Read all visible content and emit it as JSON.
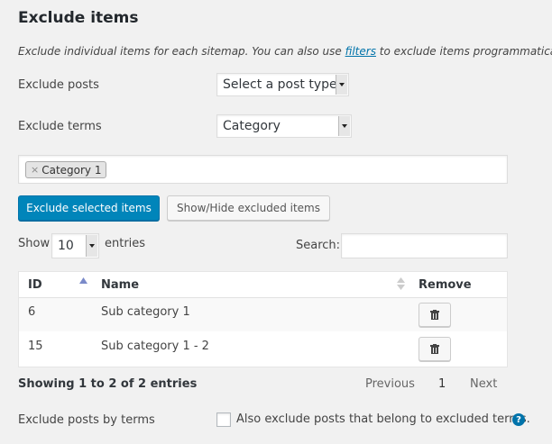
{
  "section": {
    "title": "Exclude items",
    "description_before": "Exclude individual items for each sitemap. You can also use ",
    "description_link": "filters",
    "description_after": " to exclude items programmatically."
  },
  "form": {
    "exclude_posts_label": "Exclude posts",
    "exclude_posts_select": "Select a post type",
    "exclude_terms_label": "Exclude terms",
    "exclude_terms_select": "Category",
    "selected_tag_remove": "×",
    "selected_tag": "Category 1"
  },
  "buttons": {
    "exclude_selected": "Exclude selected items",
    "show_hide": "Show/Hide excluded items"
  },
  "table_controls": {
    "show_label": "Show",
    "entries_value": "10",
    "entries_label": "entries",
    "search_label": "Search:",
    "search_value": ""
  },
  "table": {
    "columns": [
      "ID",
      "Name",
      "Remove"
    ],
    "rows": [
      {
        "id": "6",
        "name": "Sub category 1"
      },
      {
        "id": "15",
        "name": "Sub category 1 - 2"
      }
    ]
  },
  "footer": {
    "info": "Showing 1 to 2 of 2 entries",
    "previous": "Previous",
    "page": "1",
    "next": "Next"
  },
  "options": {
    "by_terms_label": "Exclude posts by terms",
    "checkbox_label": "Also exclude posts that belong to excluded terms.",
    "checked": false,
    "help": "?"
  },
  "colors": {
    "primary": "#0085ba",
    "link": "#0073aa",
    "background": "#f1f1f1"
  },
  "icons": [
    "trash-icon",
    "sort-asc-icon",
    "sort-both-icon",
    "dropdown-arrow-icon",
    "help-icon"
  ]
}
